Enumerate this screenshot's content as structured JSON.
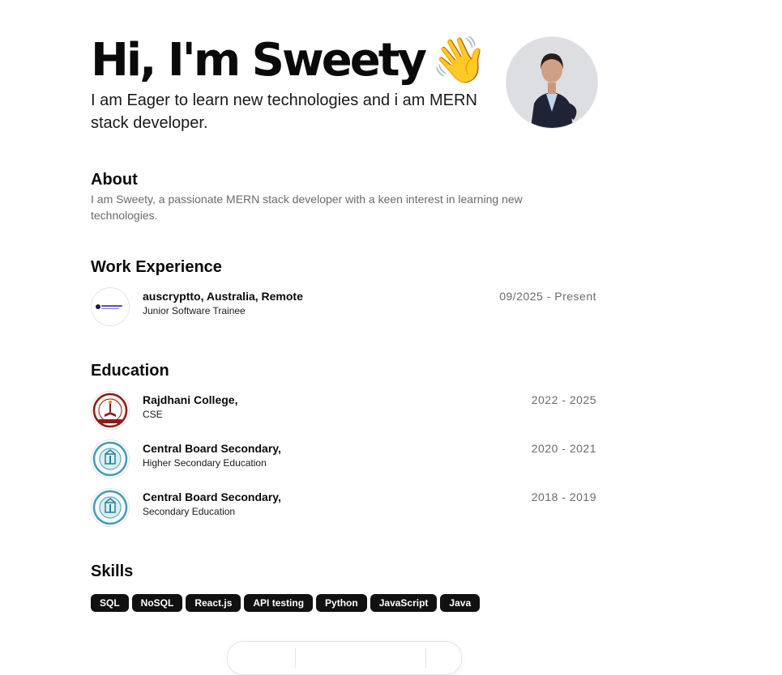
{
  "hero": {
    "title": "Hi, I'm Sweety",
    "wave": "👋",
    "subtitle": "I am Eager to learn new technologies and i am MERN stack developer."
  },
  "about": {
    "title": "About",
    "text": "I am Sweety, a passionate MERN stack developer with a keen interest in learning new technologies."
  },
  "work": {
    "title": "Work Experience",
    "items": [
      {
        "org": "auscryptto, Australia, Remote",
        "role": "Junior Software Trainee",
        "dates": "09/2025 - Present",
        "logo": "auscryptto-logo"
      }
    ]
  },
  "education": {
    "title": "Education",
    "items": [
      {
        "org": "Rajdhani College,",
        "role": "CSE",
        "dates": "2022 - 2025",
        "logo": "rajdhani-college-seal"
      },
      {
        "org": "Central Board Secondary,",
        "role": "Higher Secondary Education",
        "dates": "2020 - 2021",
        "logo": "cbse-seal"
      },
      {
        "org": "Central Board Secondary,",
        "role": "Secondary Education",
        "dates": "2018 - 2019",
        "logo": "cbse-seal"
      }
    ]
  },
  "skills": {
    "title": "Skills",
    "items": [
      "SQL",
      "NoSQL",
      "React.js",
      "API testing",
      "Python",
      "JavaScript",
      "Java"
    ]
  },
  "colors": {
    "text": "#0a0a0a",
    "muted": "#6b6b6b",
    "chip_bg": "#111111",
    "chip_text": "#ffffff"
  }
}
